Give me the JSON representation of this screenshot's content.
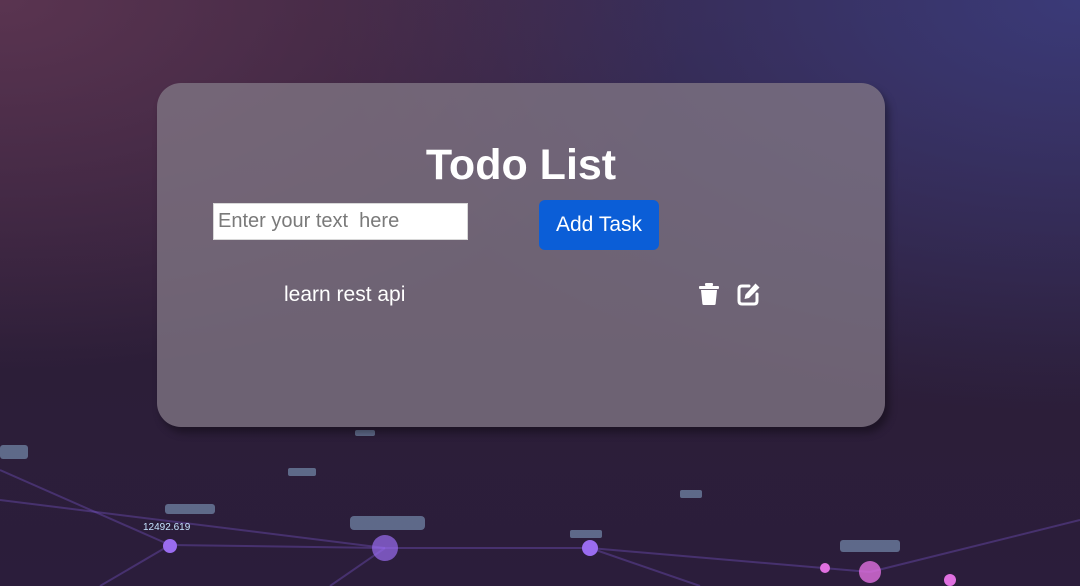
{
  "app": {
    "title": "Todo List"
  },
  "form": {
    "input_placeholder": "Enter your text  here",
    "input_value": "",
    "add_button_label": "Add Task"
  },
  "tasks": [
    {
      "text": "learn rest api",
      "actions": {
        "delete_icon": "trash-icon",
        "edit_icon": "edit-icon"
      }
    }
  ],
  "background": {
    "network_labels": [
      "12492.619"
    ]
  },
  "colors": {
    "button_primary": "#0b5ed7",
    "card_background": "#807684",
    "text": "#ffffff"
  }
}
